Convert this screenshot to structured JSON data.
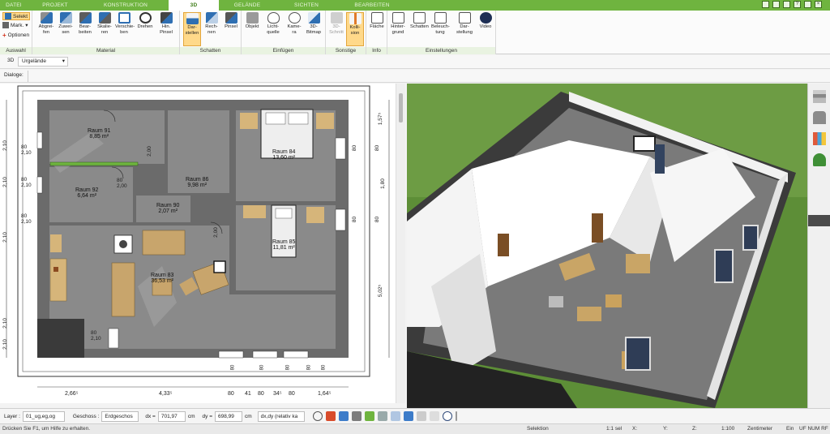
{
  "tabs": {
    "datei": "DATEI",
    "projekt": "PROJEKT",
    "konstruktion": "KONSTRUKTION",
    "tab_3d": "3D",
    "gelaende": "GELÄNDE",
    "sichten": "SICHTEN",
    "bearbeiten": "BEARBEITEN"
  },
  "ribbon": {
    "auswahl": {
      "label": "Auswahl",
      "selekt": "Selekt",
      "mark": "Mark.",
      "optionen": "Optionen"
    },
    "material": {
      "label": "Material",
      "buttons": [
        "Abgrei-\nfen",
        "Zuwei-\nsen",
        "Bear-\nbeiten",
        "Skalie-\nren",
        "Verschie-\nben",
        "Drehen",
        "Hin.\nPinsel"
      ]
    },
    "schatten": {
      "label": "Schatten",
      "buttons": [
        "Dar-\nstellen",
        "Rech-\nnen",
        "Pinsel"
      ]
    },
    "einfuegen": {
      "label": "Einfügen",
      "buttons": [
        "Objekt",
        "Licht-\nquelle",
        "Kame-\nra",
        "3D-\nBitmap"
      ]
    },
    "sonstige": {
      "label": "Sonstige",
      "buttons": [
        "3D-\nSchnitt",
        "Kolli-\nsion"
      ]
    },
    "info": {
      "label": "Info",
      "buttons": [
        "Fläche"
      ]
    },
    "einstellungen": {
      "label": "Einstellungen",
      "buttons": [
        "Hinter-\ngrund",
        "Schatten",
        "Beleuch-\ntung",
        "Dar-\nstellung",
        "Video"
      ]
    }
  },
  "toolbar2": {
    "view_mode": "3D",
    "terrain": "Urgelände"
  },
  "toolbar3": {
    "dialoge": "Dialoge:"
  },
  "plan": {
    "rooms": [
      {
        "name": "Raum 91",
        "area": "8,85 m²"
      },
      {
        "name": "Raum 92",
        "area": "6,64 m²"
      },
      {
        "name": "Raum 90",
        "area": "2,07 m²"
      },
      {
        "name": "Raum 86",
        "area": "9,98 m²"
      },
      {
        "name": "Raum 84",
        "area": "13,60 m²"
      },
      {
        "name": "Raum 85",
        "area": "11,81 m²"
      },
      {
        "name": "Raum 83",
        "area": "36,53 m²"
      }
    ],
    "left_dims": [
      "2,10",
      "2,10",
      "2,10",
      "2,10",
      "2,10"
    ],
    "right_dims": [
      "1,57⁵",
      "1,80",
      "5,02⁵"
    ],
    "bottom_dims": [
      "2,66⁵",
      "4,33⁵",
      "80",
      "41",
      "80",
      "34⁵",
      "80",
      "1,64⁵"
    ],
    "bottom_openings": [
      "80",
      "80",
      "80",
      "80",
      "80"
    ],
    "inner_labels": {
      "eighty": "80",
      "two_ten": "2,10",
      "two_hundred": "2,00"
    }
  },
  "inputbar": {
    "layer_label": "Layer :",
    "layer_value": "01_ug,eg,og",
    "geschoss_label": "Geschoss :",
    "geschoss_value": "Erdgeschos",
    "dx_label": "dx =",
    "dx_value": "701,97",
    "dx_unit": "cm",
    "dy_label": "dy =",
    "dy_value": "698,99",
    "dy_unit": "cm",
    "mode_value": "dx,dy (relativ ka"
  },
  "statusbar": {
    "help": "Drücken Sie F1, um Hilfe zu erhalten.",
    "mode": "Selektion",
    "ratio": "1:1 sel",
    "x": "X:",
    "y": "Y:",
    "z": "Z:",
    "scale": "1:100",
    "unit": "Zentimeter",
    "ein": "Ein",
    "uf": "UF NUM RF"
  },
  "colors": {
    "accent_green": "#6fb43f",
    "ribbon_group_label": "#e9f3e1",
    "selected_button": "#ffd98a",
    "floor_gray": "#6b6b6b",
    "grass": "#5f8f3a"
  }
}
